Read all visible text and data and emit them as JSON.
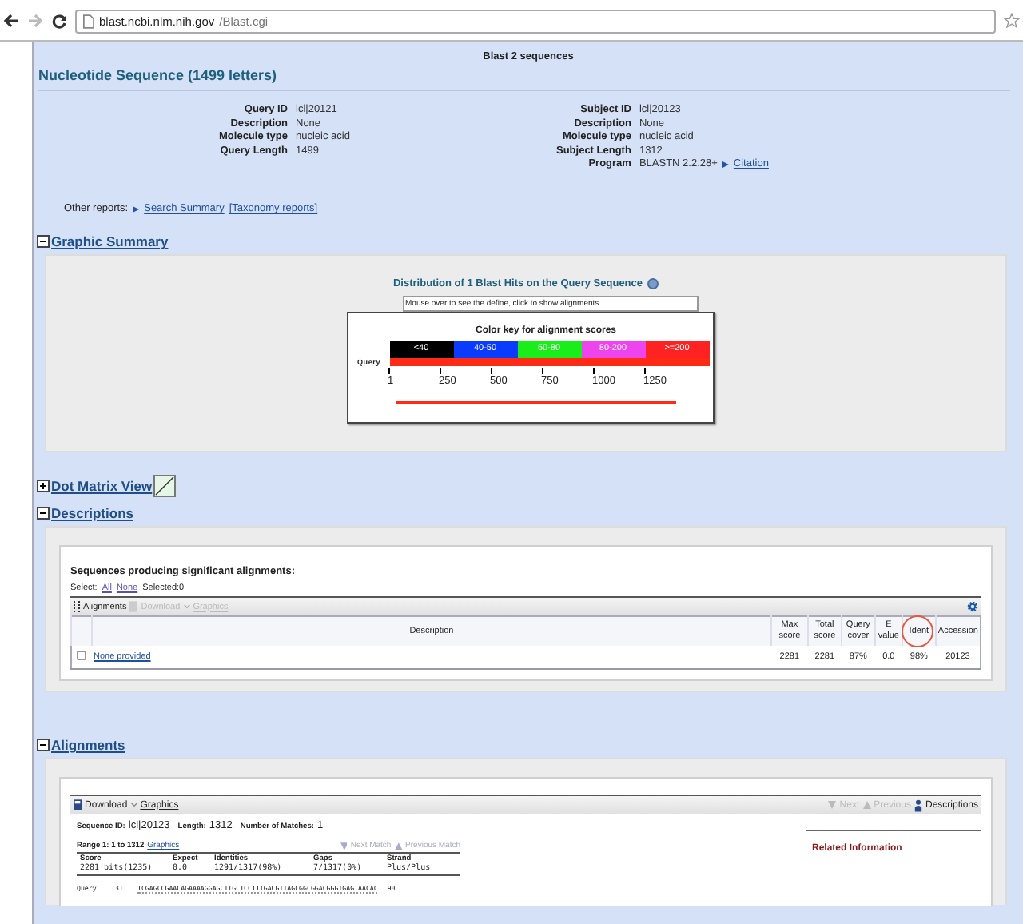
{
  "browser": {
    "url_host": "blast.ncbi.nlm.nih.gov",
    "url_path": "/Blast.cgi",
    "forward_disabled": true
  },
  "page_title": "Blast 2 sequences",
  "heading": "Nucleotide Sequence (1499 letters)",
  "query_info": [
    {
      "label": "Query ID",
      "value": "lcl|20121"
    },
    {
      "label": "Description",
      "value": "None"
    },
    {
      "label": "Molecule type",
      "value": "nucleic acid"
    },
    {
      "label": "Query Length",
      "value": "1499"
    }
  ],
  "subject_info": [
    {
      "label": "Subject ID",
      "value": "lcl|20123"
    },
    {
      "label": "Description",
      "value": "None"
    },
    {
      "label": "Molecule type",
      "value": "nucleic acid"
    },
    {
      "label": "Subject Length",
      "value": "1312"
    },
    {
      "label": "Program",
      "value": "BLASTN 2.2.28+",
      "link": "Citation"
    }
  ],
  "other_reports": {
    "label": "Other reports:",
    "links": [
      "Search Summary",
      "[Taxonomy reports]"
    ]
  },
  "graphic_summary": {
    "title": "Graphic Summary",
    "expanded": true,
    "chart_title": "Distribution of 1 Blast Hits on the Query Sequence",
    "hint": "Mouse over to see the define, click to show alignments",
    "key_title": "Color key for alignment scores",
    "key": [
      {
        "label": "<40",
        "color": "#000000"
      },
      {
        "label": "40-50",
        "color": "#0a3cff"
      },
      {
        "label": "50-80",
        "color": "#1aee1a"
      },
      {
        "label": "80-200",
        "color": "#ee44ee"
      },
      {
        "label": ">=200",
        "color": "#ff2222"
      }
    ],
    "axis_label": "Query",
    "ticks": [
      "1",
      "250",
      "500",
      "750",
      "1000",
      "1250"
    ]
  },
  "dot_matrix": {
    "title": "Dot Matrix View",
    "expanded": false
  },
  "descriptions": {
    "title": "Descriptions",
    "expanded": true,
    "subtitle": "Sequences producing significant alignments:",
    "select_label": "Select:",
    "select_links": [
      "All",
      "None"
    ],
    "selected_count": "Selected:0",
    "toolbar": [
      {
        "label": "Alignments",
        "disabled": false
      },
      {
        "label": "Download",
        "disabled": true,
        "dropdown": true
      },
      {
        "label": "Graphics",
        "disabled": true
      }
    ],
    "columns": [
      {
        "label": "Description",
        "circled": false
      },
      {
        "label": "Max score",
        "circled": false
      },
      {
        "label": "Total score",
        "circled": false
      },
      {
        "label": "Query cover",
        "circled": false
      },
      {
        "label": "E value",
        "circled": false
      },
      {
        "label": "Ident",
        "circled": true
      },
      {
        "label": "Accession",
        "circled": false
      }
    ],
    "rows": [
      {
        "checked": false,
        "cells": [
          "None provided",
          "2281",
          "2281",
          "87%",
          "0.0",
          "98%",
          "20123"
        ]
      }
    ]
  },
  "alignments": {
    "title": "Alignments",
    "expanded": true,
    "toolbar_left": [
      {
        "label": "Download",
        "disabled": false,
        "dropdown": true
      },
      {
        "label": "Graphics",
        "disabled": false
      }
    ],
    "toolbar_right": [
      {
        "label": "Next",
        "disabled": true
      },
      {
        "label": "Previous",
        "disabled": true
      },
      {
        "label": "Descriptions",
        "disabled": false
      }
    ],
    "seq_id_label": "Sequence ID:",
    "seq_id": "lcl|20123",
    "length_label": "Length:",
    "length": "1312",
    "matches_label": "Number of Matches:",
    "matches": "1",
    "range": "Range 1: 1 to 1312",
    "range_link": "Graphics",
    "match_nav": [
      {
        "label": "Next Match",
        "disabled": true
      },
      {
        "label": "Previous Match",
        "disabled": true
      }
    ],
    "stats_columns": [
      "Score",
      "Expect",
      "Identities",
      "Gaps",
      "Strand"
    ],
    "stats_values": [
      "2281 bits(1235)",
      "0.0",
      "1291/1317(98%)",
      "7/1317(0%)",
      "Plus/Plus"
    ],
    "query_line": {
      "label": "Query",
      "start": "31",
      "sequence": "TCGAGCCGAACAGAAAAGGAGCTTGCTCCTTTGACGTTAGCGGCGGACGGGTGAGTAACAC",
      "end": "90"
    },
    "related_title": "Related Information"
  }
}
